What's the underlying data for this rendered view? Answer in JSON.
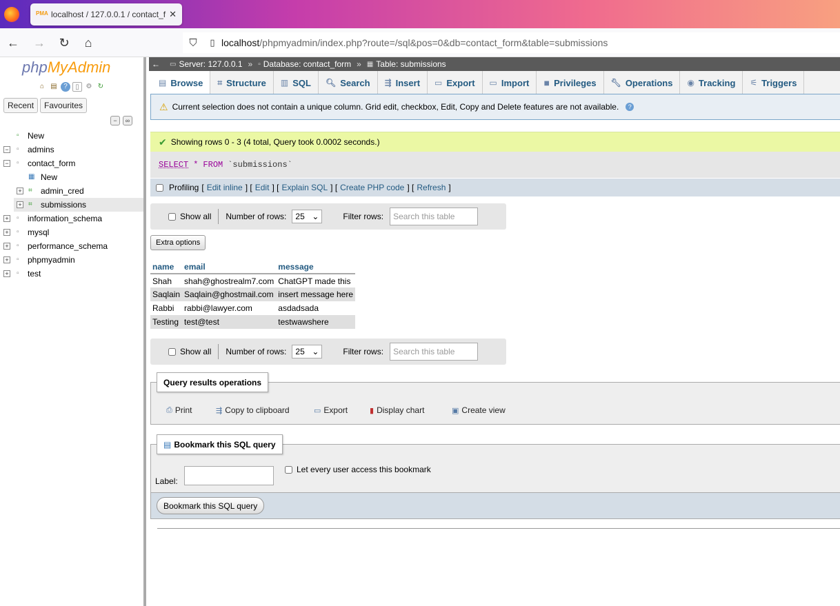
{
  "browser": {
    "tab_title": "localhost / 127.0.0.1 / contact_f",
    "url_host": "localhost",
    "url_path": "/phpmyadmin/index.php?route=/sql&pos=0&db=contact_form&table=submissions"
  },
  "sidebar": {
    "logo_php": "php",
    "logo_myadmin": "MyAdmin",
    "recent_label": "Recent",
    "favourites_label": "Favourites",
    "tree": [
      {
        "label": "New",
        "level": 0
      },
      {
        "label": "admins",
        "level": 0
      },
      {
        "label": "contact_form",
        "level": 0
      },
      {
        "label": "New",
        "level": 1
      },
      {
        "label": "admin_cred",
        "level": 1
      },
      {
        "label": "submissions",
        "level": 1
      },
      {
        "label": "information_schema",
        "level": 0
      },
      {
        "label": "mysql",
        "level": 0
      },
      {
        "label": "performance_schema",
        "level": 0
      },
      {
        "label": "phpmyadmin",
        "level": 0
      },
      {
        "label": "test",
        "level": 0
      }
    ]
  },
  "breadcrumb": {
    "server": "Server: 127.0.0.1",
    "database": "Database: contact_form",
    "table": "Table: submissions"
  },
  "menu_tabs": [
    "Browse",
    "Structure",
    "SQL",
    "Search",
    "Insert",
    "Export",
    "Import",
    "Privileges",
    "Operations",
    "Tracking",
    "Triggers"
  ],
  "warning_text": "Current selection does not contain a unique column. Grid edit, checkbox, Edit, Copy and Delete features are not available.",
  "success_text": "Showing rows 0 - 3 (4 total, Query took 0.0002 seconds.)",
  "sql": {
    "select": "SELECT",
    "star": "*",
    "from": "FROM",
    "table": "`submissions`"
  },
  "profiling": {
    "label": "Profiling",
    "links": [
      "Edit inline",
      "Edit",
      "Explain SQL",
      "Create PHP code",
      "Refresh"
    ]
  },
  "nav": {
    "show_all": "Show all",
    "number_of_rows": "Number of rows:",
    "rows_value": "25",
    "filter_rows": "Filter rows:",
    "search_placeholder": "Search this table"
  },
  "extra_options": "Extra options",
  "table": {
    "headers": [
      "name",
      "email",
      "message"
    ],
    "rows": [
      [
        "Shah",
        "shah@ghostrealm7.com",
        "ChatGPT made this"
      ],
      [
        "Saqlain",
        "Saqlain@ghostmail.com",
        "insert message here"
      ],
      [
        "Rabbi",
        "rabbi@lawyer.com",
        "asdadsada"
      ],
      [
        "Testing",
        "test@test",
        "testwawshere"
      ]
    ]
  },
  "query_ops": {
    "legend": "Query results operations",
    "buttons": [
      "Print",
      "Copy to clipboard",
      "Export",
      "Display chart",
      "Create view"
    ]
  },
  "bookmark": {
    "legend": "Bookmark this SQL query",
    "label": "Label:",
    "every_user": "Let every user access this bookmark",
    "button": "Bookmark this SQL query"
  }
}
